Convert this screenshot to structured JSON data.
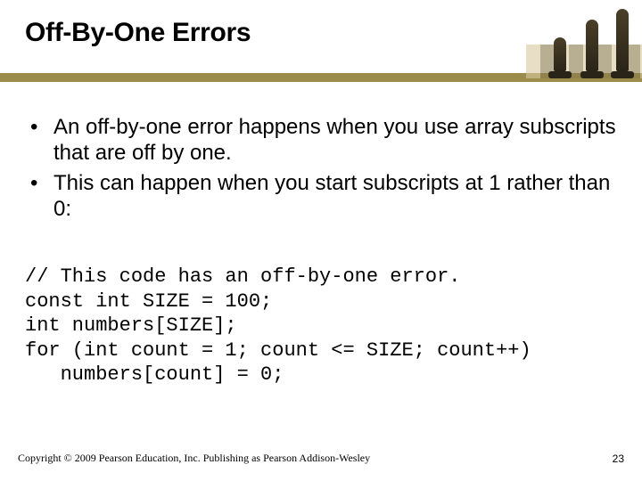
{
  "title": "Off-By-One Errors",
  "bullets": [
    "An off-by-one error happens when you use array subscripts that are off by one.",
    "This can happen when you start subscripts at 1 rather than 0:"
  ],
  "code": "// This code has an off-by-one error.\nconst int SIZE = 100;\nint numbers[SIZE];\nfor (int count = 1; count <= SIZE; count++)\n   numbers[count] = 0;",
  "footer": "Copyright © 2009 Pearson Education, Inc. Publishing as Pearson Addison-Wesley",
  "page_number": "23",
  "accent_color": "#9c8c4c"
}
